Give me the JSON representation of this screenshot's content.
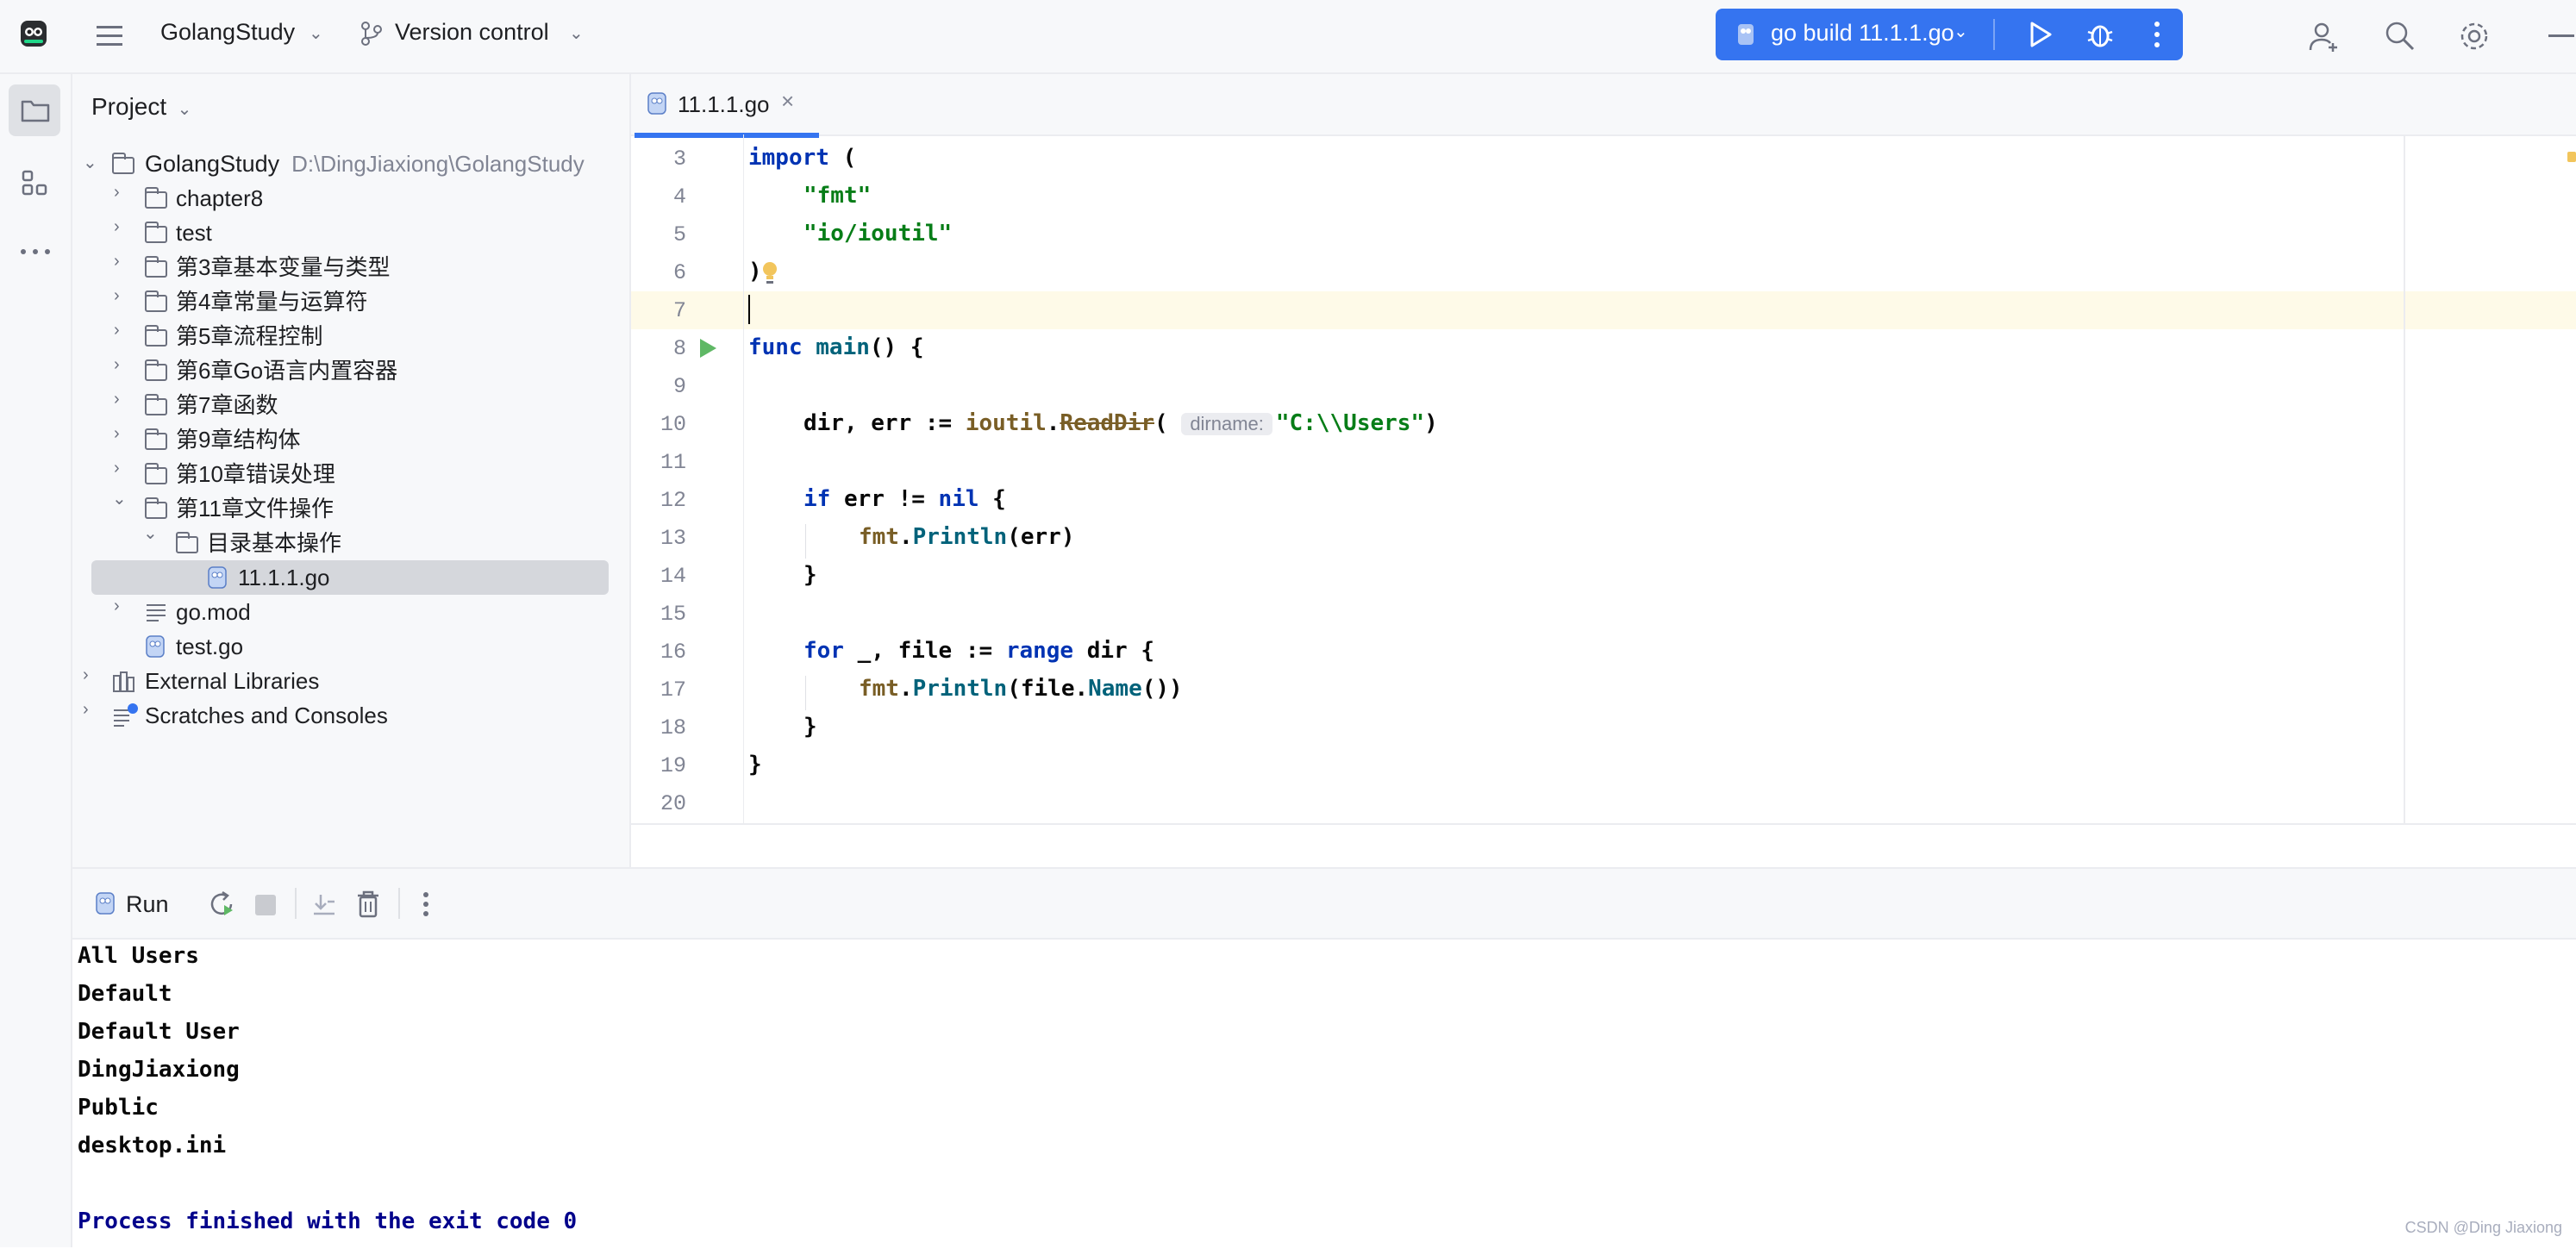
{
  "topbar": {
    "project_name": "GolangStudy",
    "vcs_label": "Version control",
    "run_config": "go build 11.1.1.go"
  },
  "sidebar": {
    "title": "Project"
  },
  "tree": {
    "root_name": "GolangStudy",
    "root_path": "D:\\DingJiaxiong\\GolangStudy",
    "items": [
      {
        "label": "chapter8"
      },
      {
        "label": "test"
      },
      {
        "label": "第3章基本变量与类型"
      },
      {
        "label": "第4章常量与运算符"
      },
      {
        "label": "第5章流程控制"
      },
      {
        "label": "第6章Go语言内置容器"
      },
      {
        "label": "第7章函数"
      },
      {
        "label": "第9章结构体"
      },
      {
        "label": "第10章错误处理"
      },
      {
        "label": "第11章文件操作"
      },
      {
        "label": "目录基本操作"
      },
      {
        "label": "11.1.1.go"
      },
      {
        "label": "go.mod"
      },
      {
        "label": "test.go"
      },
      {
        "label": "External Libraries"
      },
      {
        "label": "Scratches and Consoles"
      }
    ]
  },
  "editor": {
    "tab_label": "11.1.1.go",
    "line_numbers": [
      "3",
      "4",
      "5",
      "6",
      "7",
      "8",
      "9",
      "10",
      "11",
      "12",
      "13",
      "14",
      "15",
      "16",
      "17",
      "18",
      "19",
      "20"
    ],
    "param_hint": "dirname:",
    "tokens": {
      "import": "import",
      "lparen": "(",
      "fmt_str": "\"fmt\"",
      "ioutil_str": "\"io/ioutil\"",
      "rparen": ")",
      "func": "func",
      "main": "main",
      "main_rest": "() {",
      "dir_err": "dir, err := ",
      "ioutil": "ioutil",
      "dot": ".",
      "readdir": "ReadDir",
      "open": "(",
      "users_str": "\"C:\\\\Users\"",
      "close": ")",
      "if": "if",
      "err_ne": " err != ",
      "nil": "nil",
      "brace_open": " {",
      "fmt": "fmt",
      "println": "Println",
      "err_arg": "(err)",
      "brace_close": "}",
      "for": "for",
      "for_mid": " _, file := ",
      "range": "range",
      "for_end": " dir {",
      "file_open": "(file.",
      "name": "Name",
      "name_end": "())"
    }
  },
  "run_panel": {
    "title": "Run",
    "output": [
      "All Users",
      "Default",
      "Default User",
      "DingJiaxiong",
      "Public",
      "desktop.ini"
    ],
    "exit_message": "Process finished with the exit code 0"
  },
  "watermark": "CSDN @Ding Jiaxiong",
  "colors": {
    "accent": "#3574f0",
    "keyword": "#0033b3",
    "string": "#067d17",
    "function": "#00627a",
    "package": "#795e26",
    "exit_text": "#00008b"
  }
}
